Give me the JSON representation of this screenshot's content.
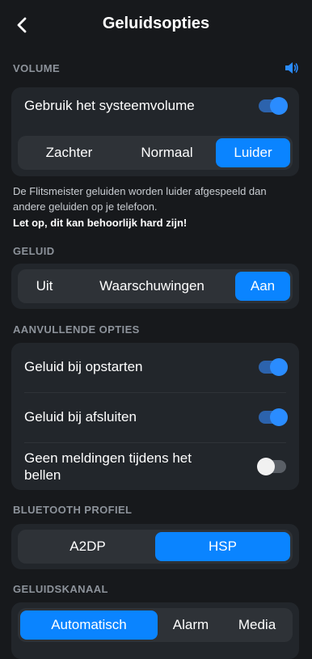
{
  "header": {
    "title": "Geluidsopties"
  },
  "volume": {
    "section_title": "VOLUME",
    "system_volume_label": "Gebruik het systeemvolume",
    "system_volume_on": true,
    "options": [
      "Zachter",
      "Normaal",
      "Luider"
    ],
    "selected": "Luider",
    "description": "De Flitsmeister geluiden worden luider afgespeeld dan andere geluiden op je telefoon.",
    "warning": "Let op, dit kan behoorlijk hard zijn!"
  },
  "sound": {
    "section_title": "GELUID",
    "options": [
      "Uit",
      "Waarschuwingen",
      "Aan"
    ],
    "selected": "Aan"
  },
  "extra": {
    "section_title": "AANVULLENDE OPTIES",
    "startup_label": "Geluid bij opstarten",
    "startup_on": true,
    "shutdown_label": "Geluid bij afsluiten",
    "shutdown_on": true,
    "calls_label": "Geen meldingen tijdens het bellen",
    "calls_on": false
  },
  "bluetooth": {
    "section_title": "BLUETOOTH PROFIEL",
    "options": [
      "A2DP",
      "HSP"
    ],
    "selected": "HSP"
  },
  "channel": {
    "section_title": "GELUIDSKANAAL",
    "options": [
      "Automatisch",
      "Alarm",
      "Media"
    ],
    "selected": "Automatisch"
  },
  "colors": {
    "accent": "#0a84ff",
    "background": "#17191c",
    "card": "#22262b"
  },
  "icons": {
    "back": "chevron-left-icon",
    "volume": "speaker-icon"
  }
}
